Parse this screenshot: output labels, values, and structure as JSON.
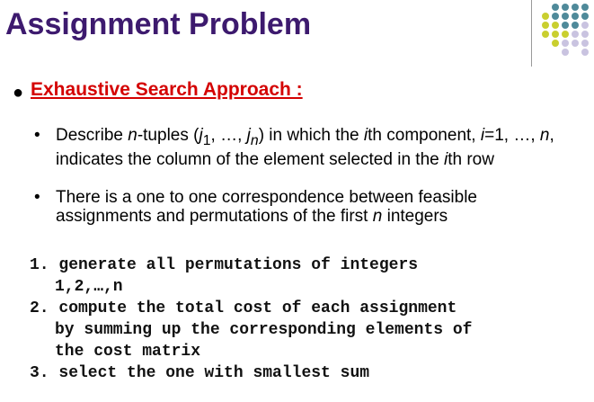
{
  "slide": {
    "title": "Assignment Problem",
    "heading": "Exhaustive Search Approach :",
    "bullets": [
      {
        "text_html": "Describe <i>n</i>-tuples (<i>j</i><sub>1</sub>, …, <i>j<sub>n</sub></i>) in which the <i>i</i>th component, <i>i</i>=1, …, <i>n</i>, indicates the column of the element selected in the <i>i</i>th row"
      },
      {
        "text_html": "There is a one to one correspondence between feasible assignments and permutations of the first <i>n</i> integers"
      }
    ],
    "steps": [
      {
        "lines": [
          "1. generate all permutations of integers",
          "1,2,…,n"
        ]
      },
      {
        "lines": [
          "2. compute the total cost of each assignment",
          "by summing up the corresponding elements of",
          "the cost matrix"
        ]
      },
      {
        "lines": [
          "3. select the one with smallest sum"
        ]
      }
    ]
  },
  "colors": {
    "title": "#3d1a6e",
    "heading": "#d40000",
    "dot_teal": "#4f8a9a",
    "dot_yellow": "#c9cf2f",
    "dot_lavender": "#c9c3e0"
  }
}
